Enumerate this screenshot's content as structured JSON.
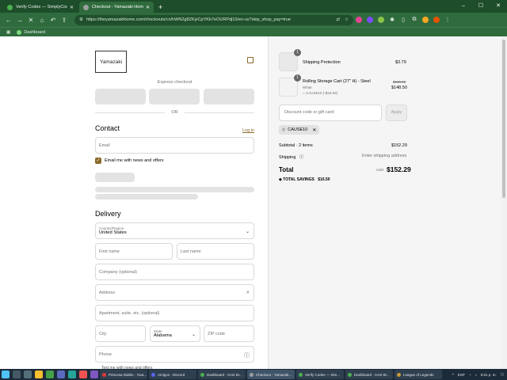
{
  "browser": {
    "tabs": [
      {
        "title": "Verify Codes — SimplyCodes",
        "active": false,
        "color": "#4caf50"
      },
      {
        "title": "Checkout - Yamazaki Home",
        "active": true,
        "color": "#9e9e9e"
      }
    ],
    "url": "https://theyamazakihome.com/checkouts/cn/hWN2g8ZKjvCpYKb7eOURPdj10/en-us?skip_shop_pay=true",
    "bookmark": "Dashboard"
  },
  "checkout": {
    "logo": "Yamazaki",
    "express_label": "Express checkout",
    "or_label": "OR",
    "contact": {
      "heading": "Contact",
      "login_link": "Log in",
      "email_placeholder": "Email",
      "newsletter_label": "Email me with news and offers"
    },
    "delivery": {
      "heading": "Delivery",
      "country_label": "Country/Region",
      "country_value": "United States",
      "first_name": "First name",
      "last_name": "Last name",
      "company": "Company (optional)",
      "address": "Address",
      "apartment": "Apartment, suite, etc. (optional)",
      "city": "City",
      "state_label": "State",
      "state_value": "Alabama",
      "zip": "ZIP code",
      "phone": "Phone",
      "cut_text": "Text me with news and offers"
    }
  },
  "summary": {
    "items": [
      {
        "qty": "1",
        "name": "Shipping Protection",
        "variant": "",
        "discount": "",
        "old_price": "",
        "price": "$3.79"
      },
      {
        "qty": "1",
        "name": "Rolling Storage Cart (27\" H) - Steel",
        "variant": "White",
        "discount": "CAUSE10 (-$16.50)",
        "old_price": "$165.00",
        "price": "$148.50"
      }
    ],
    "discount_placeholder": "Discount code or gift card",
    "apply_label": "Apply",
    "applied_code": "CAUSE10",
    "subtotal_label": "Subtotal · 2 items",
    "subtotal_value": "$152.29",
    "shipping_label": "Shipping",
    "shipping_value": "Enter shipping address",
    "total_label": "Total",
    "currency": "USD",
    "total_value": "$152.29",
    "savings_label": "TOTAL SAVINGS",
    "savings_value": "$16.50"
  },
  "taskbar": {
    "buttons": [
      {
        "label": "Princesa Diablo - Yout...",
        "color": "#e53935"
      },
      {
        "label": "Amigos - Discord",
        "color": "#5865f2"
      },
      {
        "label": "Dashboard - Cent Br...",
        "color": "#4caf50"
      },
      {
        "label": "Checkout - Yamazak...",
        "color": "#9e9e9e"
      },
      {
        "label": "Verify Codes — Sim...",
        "color": "#4caf50"
      },
      {
        "label": "Dashboard - Cent Br...",
        "color": "#4caf50"
      },
      {
        "label": "League of Legends",
        "color": "#c89b3c"
      }
    ],
    "lang": "ESP",
    "time": "6:51 p. m."
  }
}
